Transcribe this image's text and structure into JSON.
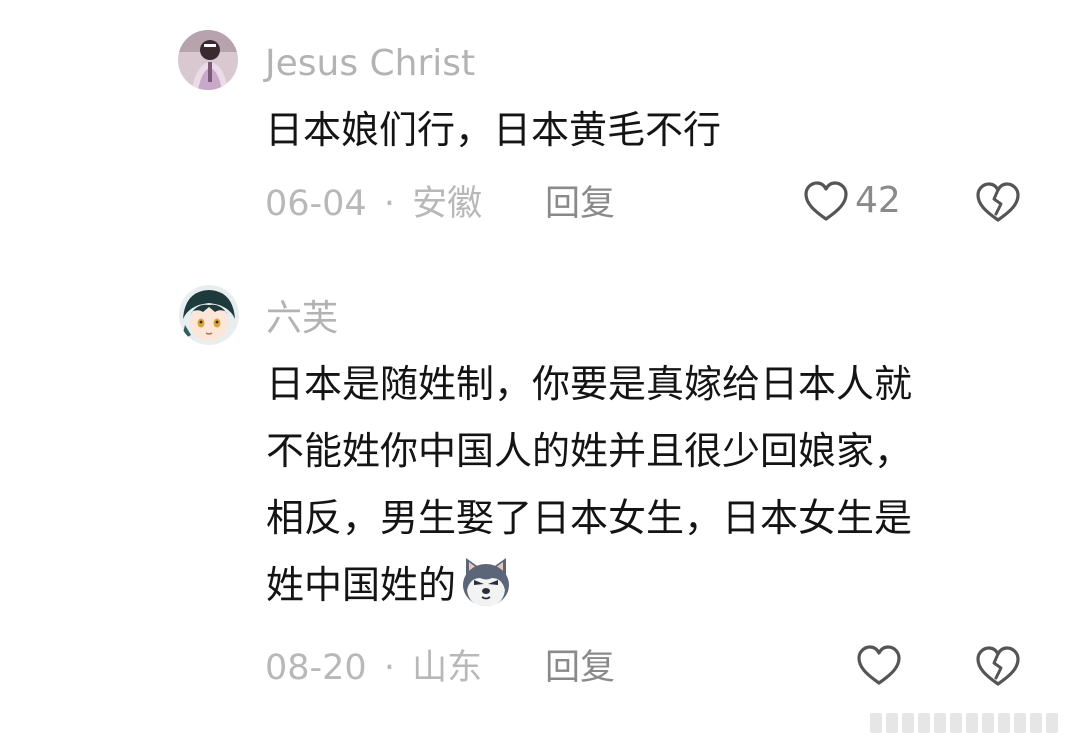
{
  "comments": [
    {
      "username": "Jesus Christ",
      "text_lines": [
        "日本娘们行，日本黄毛不行"
      ],
      "date": "06-04",
      "separator": "·",
      "location": "安徽",
      "reply_label": "回复",
      "like_count": "42"
    },
    {
      "username": "六芙",
      "text_lines": [
        "日本是随姓制，你要是真嫁给日本人就",
        "不能姓你中国人的姓并且很少回娘家，",
        "相反，男生娶了日本女生，日本女生是",
        "姓中国姓的"
      ],
      "emoji": "dog-emoji",
      "date": "08-20",
      "separator": "·",
      "location": "山东",
      "reply_label": "回复",
      "like_count": ""
    }
  ],
  "colors": {
    "text": "#141414",
    "meta": "#b8b8b8",
    "action": "#8a8a8a"
  }
}
